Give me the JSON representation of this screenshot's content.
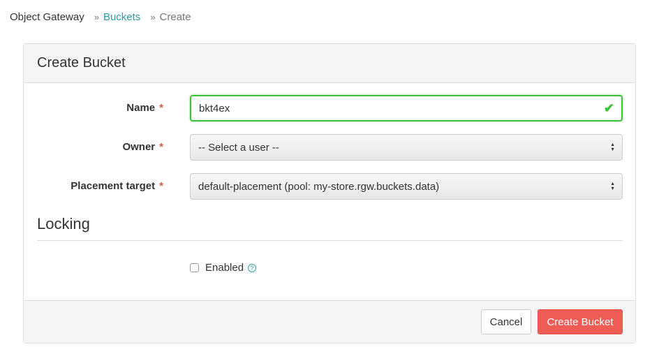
{
  "breadcrumb": {
    "root": "Object Gateway",
    "separator": "»",
    "link": "Buckets",
    "current": "Create"
  },
  "panel": {
    "title": "Create Bucket"
  },
  "form": {
    "name": {
      "label": "Name",
      "required": "*",
      "value": "bkt4ex",
      "state": "valid"
    },
    "owner": {
      "label": "Owner",
      "required": "*",
      "value": "-- Select a user --"
    },
    "placement": {
      "label": "Placement target",
      "required": "*",
      "value": "default-placement (pool: my-store.rgw.buckets.data)"
    }
  },
  "locking": {
    "title": "Locking",
    "enabled_label": "Enabled",
    "enabled_checked": false,
    "help_glyph": "?"
  },
  "footer": {
    "cancel_label": "Cancel",
    "create_label": "Create Bucket"
  },
  "colors": {
    "accent_link": "#2a9ca5",
    "valid_border": "#3cc13a",
    "required": "#d9534f",
    "primary_button": "#ef5c55"
  }
}
